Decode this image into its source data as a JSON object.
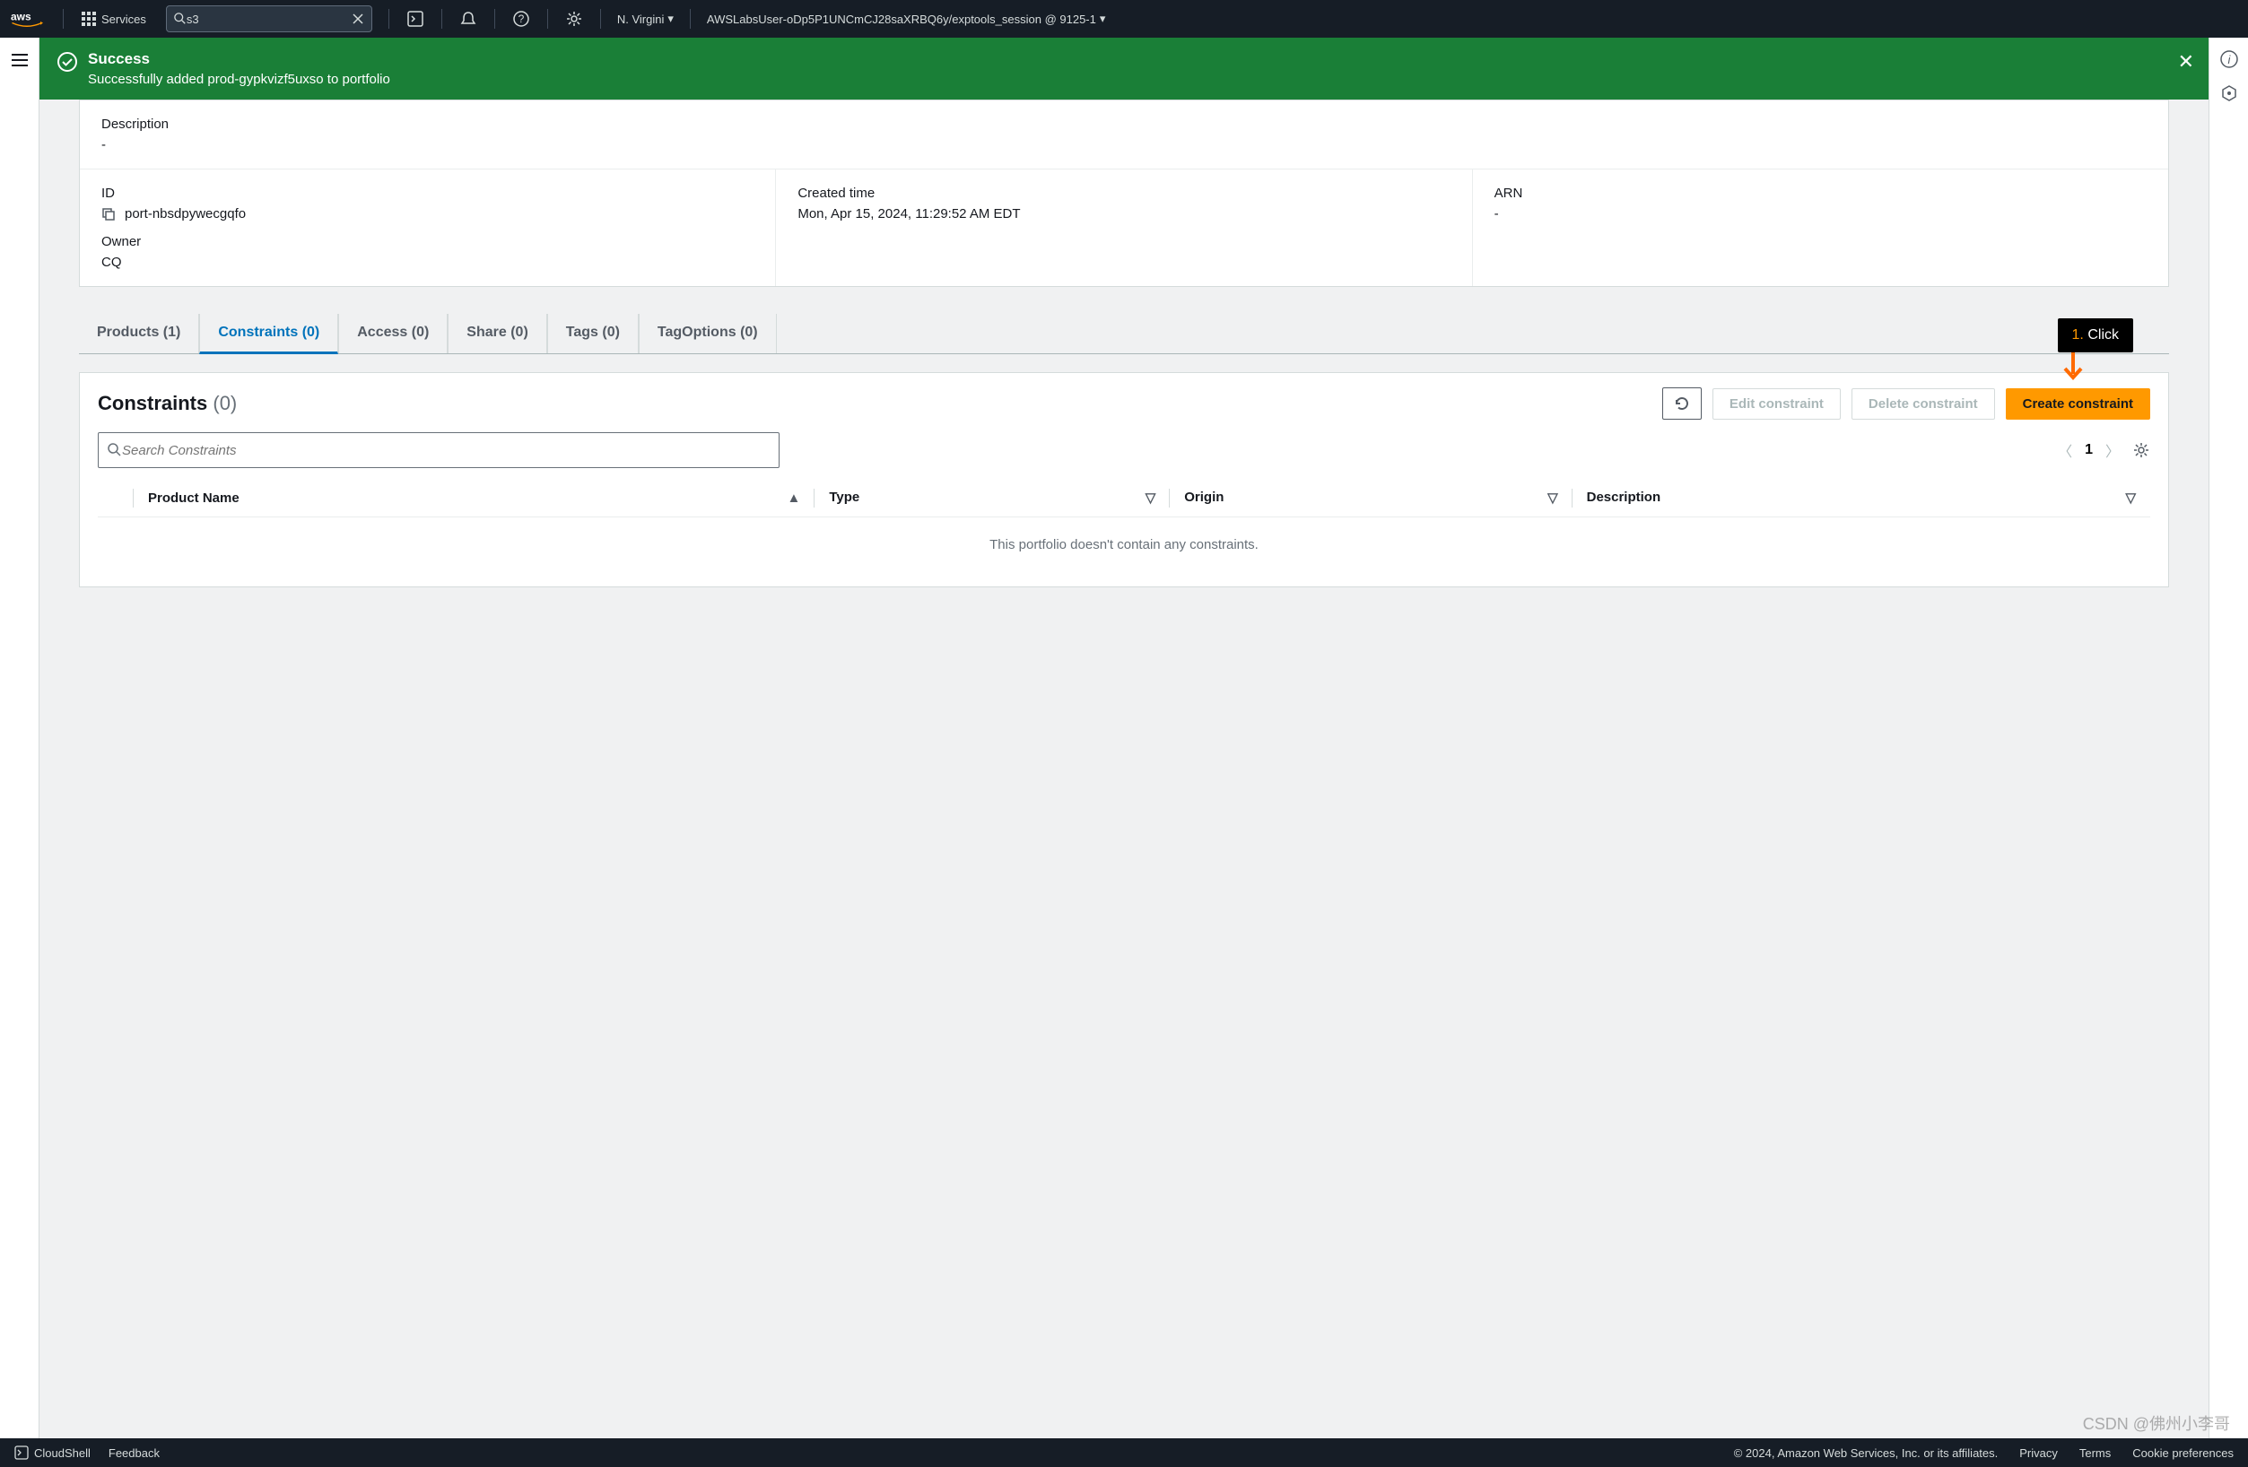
{
  "nav": {
    "logo": "aws",
    "services": "Services",
    "search_value": "s3",
    "region": "N. Virgini",
    "account": "AWSLabsUser-oDp5P1UNCmCJ28saXRBQ6y/exptools_session @ 9125-1"
  },
  "banner": {
    "title": "Success",
    "message": "Successfully added prod-gypkvizf5uxso to portfolio"
  },
  "details": {
    "description_label": "Description",
    "description_value": "-",
    "id_label": "ID",
    "id_value": "port-nbsdpywecgqfo",
    "created_label": "Created time",
    "created_value": "Mon, Apr 15, 2024, 11:29:52 AM EDT",
    "arn_label": "ARN",
    "arn_value": "-",
    "owner_label": "Owner",
    "owner_value": "CQ"
  },
  "tabs": {
    "products": "Products (1)",
    "constraints": "Constraints (0)",
    "access": "Access (0)",
    "share": "Share (0)",
    "tags": "Tags (0)",
    "tagoptions": "TagOptions (0)"
  },
  "constraints": {
    "title": "Constraints",
    "count": "(0)",
    "refresh": "⟳",
    "edit": "Edit constraint",
    "delete": "Delete constraint",
    "create": "Create constraint",
    "search_placeholder": "Search Constraints",
    "page": "1",
    "columns": {
      "product": "Product Name",
      "type": "Type",
      "origin": "Origin",
      "description": "Description"
    },
    "empty": "This portfolio doesn't contain any constraints."
  },
  "tip": {
    "num": "1.",
    "text": "Click"
  },
  "footer": {
    "cloudshell": "CloudShell",
    "feedback": "Feedback",
    "copyright": "© 2024, Amazon Web Services, Inc. or its affiliates.",
    "privacy": "Privacy",
    "terms": "Terms",
    "cookies": "Cookie preferences"
  },
  "watermark": "CSDN @佛州小李哥"
}
